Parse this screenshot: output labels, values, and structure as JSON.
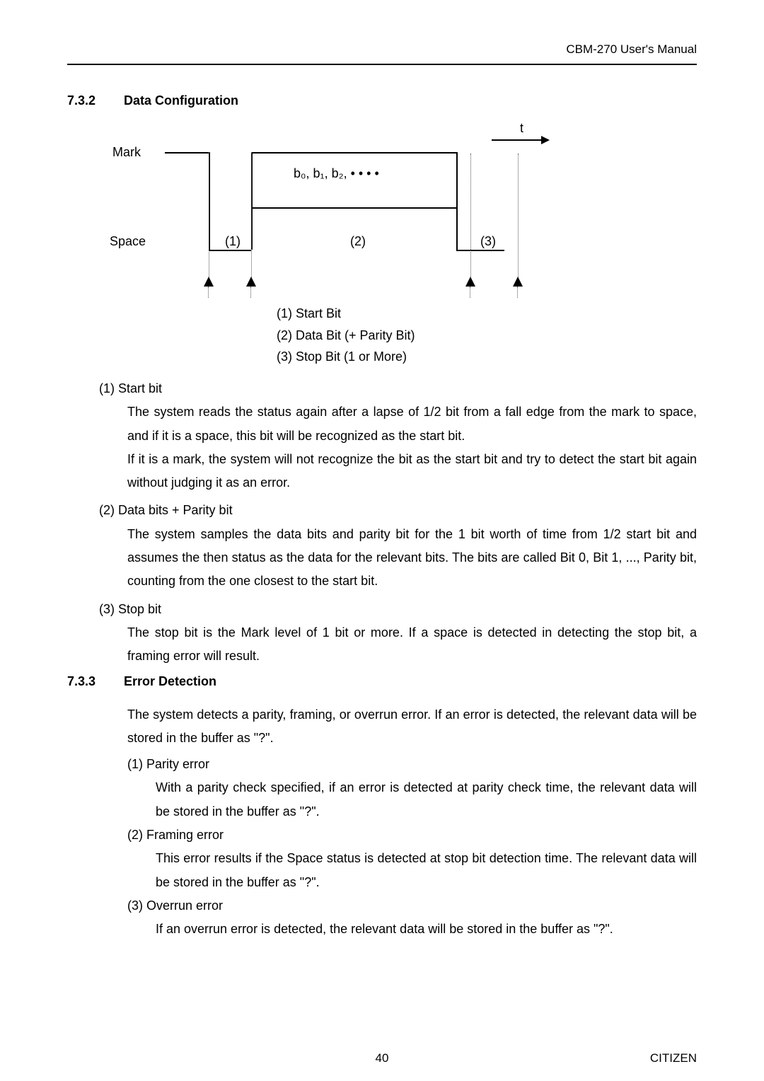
{
  "header": "CBM-270 User's Manual",
  "section1": {
    "num": "7.3.2",
    "title": "Data Configuration"
  },
  "diagram": {
    "mark": "Mark",
    "space": "Space",
    "t": "t",
    "bits": "b₀, b₁, b₂, • • • •",
    "n1": "(1)",
    "n2": "(2)",
    "n3": "(3)",
    "cap1": "(1) Start Bit",
    "cap2": "(2) Data Bit (+ Parity Bit)",
    "cap3": "(3) Stop Bit (1 or More)"
  },
  "items": {
    "i1": "(1)  Start bit",
    "i1p1": "The system reads the status again after a lapse of 1/2 bit from a fall edge from the mark to space, and if it is a space, this bit will be recognized as the start bit.",
    "i1p2": "If it is a mark, the system will not recognize the bit as the start bit and try to detect the start bit again without judging it as an error.",
    "i2": "(2)  Data bits + Parity bit",
    "i2p1": "The system samples the data bits and parity bit for the 1 bit worth of time from 1/2 start bit and assumes the then status as the data for the relevant bits.   The bits are called Bit 0, Bit 1, ..., Parity bit, counting from the one closest to the start bit.",
    "i3": "(3)  Stop bit",
    "i3p1": "The stop bit is the Mark level of 1 bit or more.   If a space is detected in detecting the stop bit, a framing error will result."
  },
  "section2": {
    "num": "7.3.3",
    "title": "Error Detection"
  },
  "err": {
    "intro": "The system detects a parity, framing, or overrun error.   If an error is detected, the relevant data will be stored in the buffer as \"?\".",
    "e1": "(1)  Parity error",
    "e1p": "With a parity check specified, if an error is detected at parity check time, the relevant data will be stored in the buffer as \"?\".",
    "e2": "(2)  Framing error",
    "e2p": "This error results if the Space status is detected at stop bit detection time.  The relevant data will be stored in the buffer as \"?\".",
    "e3": "(3)  Overrun error",
    "e3p": "If an overrun error is detected, the relevant data will be stored in the buffer as \"?\"."
  },
  "footer": {
    "page": "40",
    "brand": "CITIZEN"
  }
}
